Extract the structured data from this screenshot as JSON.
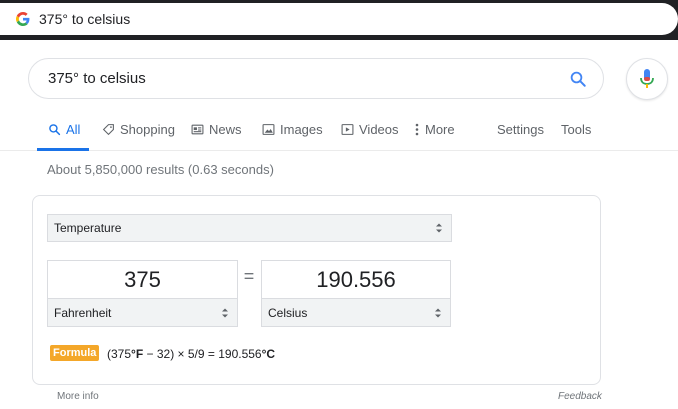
{
  "browser": {
    "address_text": "375° to celsius"
  },
  "search": {
    "query": "375° to celsius"
  },
  "tabs": [
    {
      "label": "All",
      "icon": "search-icon",
      "active": true
    },
    {
      "label": "Shopping",
      "icon": "tag-icon",
      "active": false
    },
    {
      "label": "News",
      "icon": "newspaper-icon",
      "active": false
    },
    {
      "label": "Images",
      "icon": "image-icon",
      "active": false
    },
    {
      "label": "Videos",
      "icon": "play-icon",
      "active": false
    },
    {
      "label": "More",
      "icon": "more-vertical-icon",
      "active": false
    }
  ],
  "tools": {
    "settings_label": "Settings",
    "tools_label": "Tools"
  },
  "result_stats": "About 5,850,000 results (0.63 seconds)",
  "converter": {
    "unit_type": "Temperature",
    "from_value": "375",
    "to_value": "190.556",
    "equals_sign": "=",
    "from_unit": "Fahrenheit",
    "to_unit": "Celsius",
    "formula_label": "Formula",
    "formula_prefix": "(375",
    "formula_from_unit": "°F",
    "formula_middle": " − 32) × 5/9 = 190.556",
    "formula_to_unit": "°C"
  },
  "footer": {
    "more_info": "More info",
    "feedback": "Feedback"
  },
  "colors": {
    "accent": "#1a73e8",
    "formula_badge": "#f4a729"
  }
}
